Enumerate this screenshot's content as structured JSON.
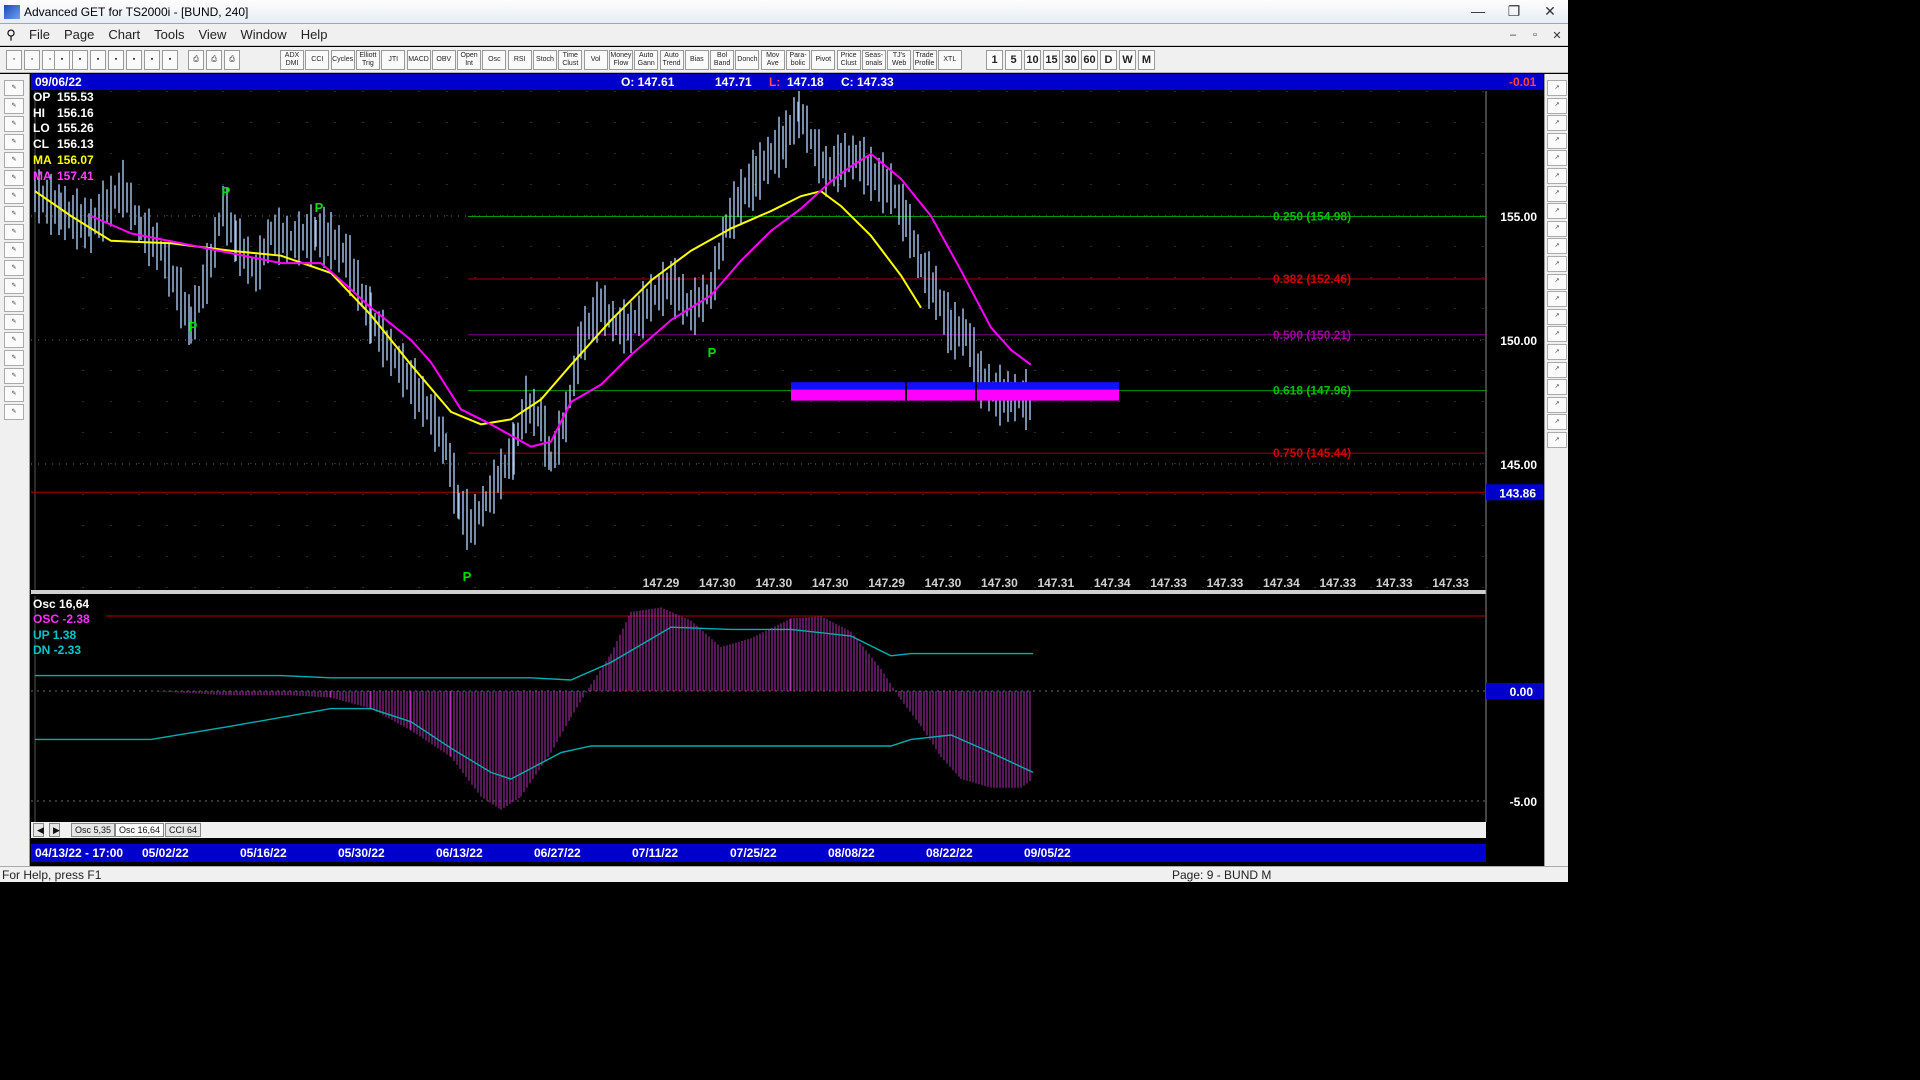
{
  "window": {
    "title": "Advanced GET for TS2000i - [BUND, 240]"
  },
  "menu": [
    "File",
    "Page",
    "Chart",
    "Tools",
    "View",
    "Window",
    "Help"
  ],
  "toolbar": {
    "studies": [
      "ADX DMI",
      "CCI",
      "Cycles",
      "Elliott Trig",
      "JTI",
      "MACD",
      "OBV",
      "Open Int",
      "Osc",
      "RSI",
      "Stoch",
      "Time Clust",
      "Vol",
      "Money Flow",
      "Auto Gann",
      "Auto Trend",
      "Bias",
      "Bol Band",
      "Donch",
      "Mov Ave",
      "Para- bolic",
      "Pivot",
      "Price Clust",
      "Seas- onals",
      "TJ's Web",
      "Trade Profile",
      "XTL"
    ],
    "intervals": [
      "1",
      "5",
      "10",
      "15",
      "30",
      "60",
      "D",
      "W",
      "M"
    ]
  },
  "info": {
    "date": "09/06/22",
    "open": "O: 147.61",
    "high": "147.71",
    "low": "147.18",
    "close": "C: 147.33",
    "low_prefix": "L:",
    "change": "-0.01"
  },
  "legend": {
    "op": {
      "label": "OP",
      "value": "155.53"
    },
    "hi": {
      "label": "HI",
      "value": "156.16"
    },
    "lo": {
      "label": "LO",
      "value": "155.26"
    },
    "cl": {
      "label": "CL",
      "value": "156.13"
    },
    "ma1": {
      "label": "MA",
      "value": "156.07"
    },
    "ma2": {
      "label": "MA",
      "value": "157.41"
    }
  },
  "pivot_marker": "P",
  "colors": {
    "ma_fast": "#ffff00",
    "ma_slow": "#ff00ff",
    "bars": "#a8c8f0",
    "osc": "#b030b0",
    "osc_band": "#00b0b0",
    "zone_blue": "#1010ff",
    "zone_magenta": "#ff00ff"
  },
  "fib_levels": [
    {
      "label": "0.250 (154.98)",
      "price": 154.98,
      "color": "#00c000"
    },
    {
      "label": "0.382 (152.46)",
      "price": 152.46,
      "color": "#d00000"
    },
    {
      "label": "0.500 (150.21)",
      "price": 150.21,
      "color": "#a000a0"
    },
    {
      "label": "0.618 (147.96)",
      "price": 147.96,
      "color": "#00c000"
    },
    {
      "label": "0.750 (145.44)",
      "price": 145.44,
      "color": "#d00000"
    }
  ],
  "price_axis": [
    {
      "label": "155.00",
      "value": 155
    },
    {
      "label": "150.00",
      "value": 150
    },
    {
      "label": "145.00",
      "value": 145
    }
  ],
  "last_price_label": "143.86",
  "last_price": 143.86,
  "projection_prices": [
    "147.29",
    "147.30",
    "147.30",
    "147.30",
    "147.29",
    "147.30",
    "147.30",
    "147.31",
    "147.34",
    "147.33",
    "147.33",
    "147.34",
    "147.33",
    "147.33",
    "147.33"
  ],
  "oscillator": {
    "title": "Osc 16,64",
    "osc": "OSC -2.38",
    "up": "UP   1.38",
    "dn": "DN   -2.33",
    "axis": [
      {
        "label": "0.00",
        "value": 0
      },
      {
        "label": "-5.00",
        "value": -5
      }
    ]
  },
  "tabs": [
    "Osc 5,35",
    "Osc 16,64",
    "CCI 64"
  ],
  "dates": [
    "04/13/22 - 17:00",
    "05/02/22",
    "05/16/22",
    "05/30/22",
    "06/13/22",
    "06/27/22",
    "07/11/22",
    "07/25/22",
    "08/08/22",
    "08/22/22",
    "09/05/22"
  ],
  "status": {
    "help": "For Help, press F1",
    "page": "Page: 9 - BUND M"
  }
}
